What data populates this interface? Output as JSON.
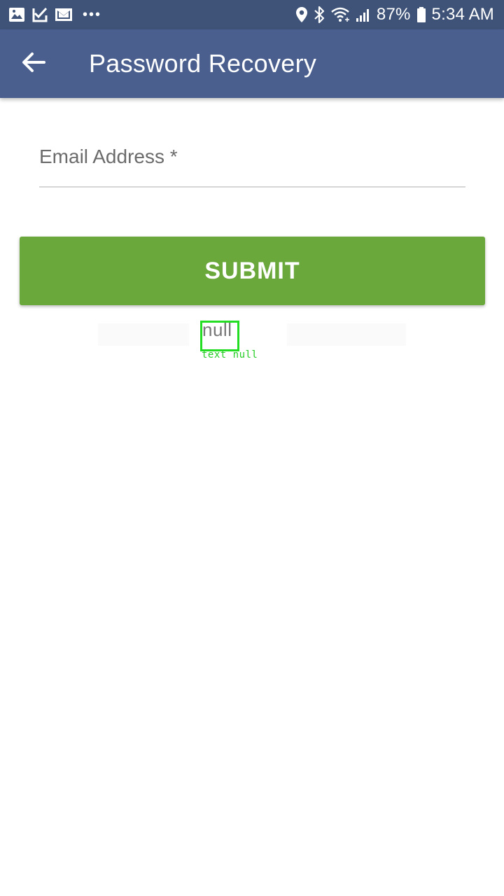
{
  "status_bar": {
    "battery_percent": "87%",
    "time": "5:34 AM",
    "more_indicator": "•••",
    "left_icons": [
      "image-icon",
      "check-doc-icon",
      "gmail-icon"
    ],
    "right_icons": [
      "location-icon",
      "bluetooth-icon",
      "wifi-icon",
      "signal-icon",
      "battery-icon"
    ]
  },
  "toolbar": {
    "title": "Password Recovery",
    "back_icon": "arrow-back-icon",
    "background_color": "#4a5f8e"
  },
  "form": {
    "email_label": "Email Address *",
    "email_value": "",
    "submit_label": "SUBMIT",
    "submit_color": "#6aa83b"
  },
  "debug_overlay": {
    "text": "null",
    "caption": "text null",
    "box_color": "#22dd22"
  }
}
